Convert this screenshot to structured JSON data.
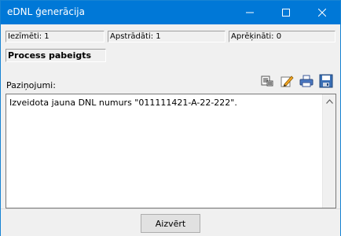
{
  "window": {
    "title": "eDNL ģenerācija"
  },
  "status": {
    "marked": "Iezīmēti: 1",
    "processed": "Apstrādāti: 1",
    "calculated": "Aprēķināti: 0",
    "process_state": "Process pabeigts"
  },
  "notifications": {
    "label": "Paziņojumi:",
    "text": "Izveidota jauna DNL numurs \"011111421-A-22-222\"."
  },
  "toolbar": {
    "icons": [
      "copy-list-icon",
      "edit-pencil-icon",
      "printer-icon",
      "save-disk-icon"
    ]
  },
  "footer": {
    "close_label": "Aizvērt"
  },
  "colors": {
    "titlebar": "#0078d7",
    "background": "#f0f0f0"
  }
}
